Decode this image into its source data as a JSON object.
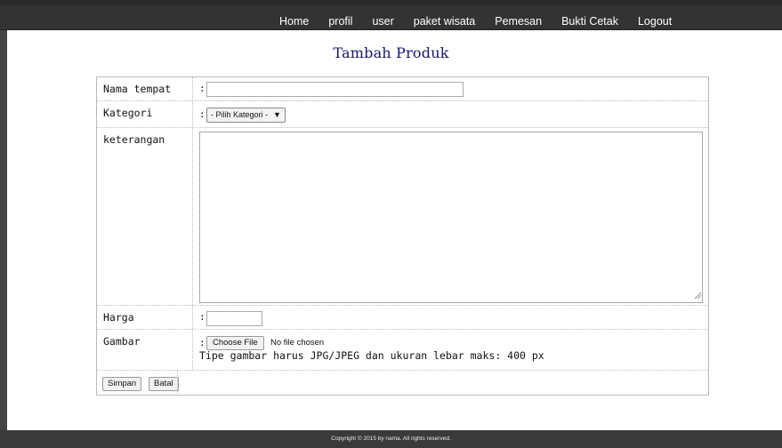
{
  "nav": {
    "items": [
      "Home",
      "profil",
      "user",
      "paket wisata",
      "Pemesan",
      "Bukti Cetak",
      "Logout"
    ]
  },
  "page": {
    "title": "Tambah Produk"
  },
  "form": {
    "nama_tempat": {
      "label": "Nama tempat",
      "colon": ":",
      "value": ""
    },
    "kategori": {
      "label": "Kategori",
      "colon": ":",
      "selected": "- Pilih Kategori -"
    },
    "keterangan": {
      "label": "keterangan",
      "value": ""
    },
    "harga": {
      "label": "Harga",
      "colon": ":",
      "value": ""
    },
    "gambar": {
      "label": "Gambar",
      "colon": ":",
      "choose_label": "Choose File",
      "no_file": "No file chosen",
      "hint": "Tipe gambar harus JPG/JPEG dan ukuran lebar maks: 400 px"
    },
    "buttons": {
      "save": "Simpan",
      "cancel": "Batal"
    }
  },
  "footer": {
    "text": "Copyright © 2015 by nama. All rights reserved."
  },
  "colors": {
    "nav_bg": "#333333",
    "title": "#15156a",
    "footer_bg": "#3a3a3a"
  }
}
